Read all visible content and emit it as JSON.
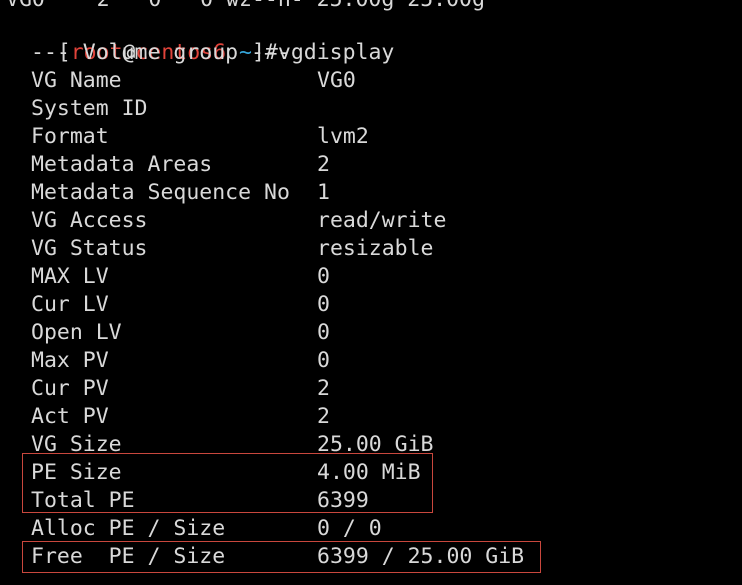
{
  "terminal": {
    "clipped_top_line": "VG0    2   0   0 wz--n- 25.00g 25.00g",
    "prompt": {
      "open_bracket": "[",
      "user": "root",
      "at": "@",
      "host": "centos6",
      "space": " ",
      "cwd": "~",
      "close_and_hash": "]#",
      "command": "vgdisplay"
    },
    "section_header": "--- Volume group ---",
    "rows": [
      {
        "key": "VG Name",
        "value": "VG0"
      },
      {
        "key": "System ID",
        "value": ""
      },
      {
        "key": "Format",
        "value": "lvm2"
      },
      {
        "key": "Metadata Areas",
        "value": "2"
      },
      {
        "key": "Metadata Sequence No",
        "value": "1"
      },
      {
        "key": "VG Access",
        "value": "read/write"
      },
      {
        "key": "VG Status",
        "value": "resizable"
      },
      {
        "key": "MAX LV",
        "value": "0"
      },
      {
        "key": "Cur LV",
        "value": "0"
      },
      {
        "key": "Open LV",
        "value": "0"
      },
      {
        "key": "Max PV",
        "value": "0"
      },
      {
        "key": "Cur PV",
        "value": "2"
      },
      {
        "key": "Act PV",
        "value": "2"
      },
      {
        "key": "VG Size",
        "value": "25.00 GiB"
      },
      {
        "key": "PE Size",
        "value": "4.00 MiB"
      },
      {
        "key": "Total PE",
        "value": "6399"
      },
      {
        "key": "Alloc PE / Size",
        "value": "0 / 0"
      },
      {
        "key": "Free  PE / Size",
        "value": "6399 / 25.00 GiB"
      }
    ]
  },
  "colors": {
    "background": "#000000",
    "text": "#d9d9d9",
    "prompt_user_host": "#e0433a",
    "prompt_cwd": "#35a5d9",
    "highlight_box": "#c9473d"
  }
}
